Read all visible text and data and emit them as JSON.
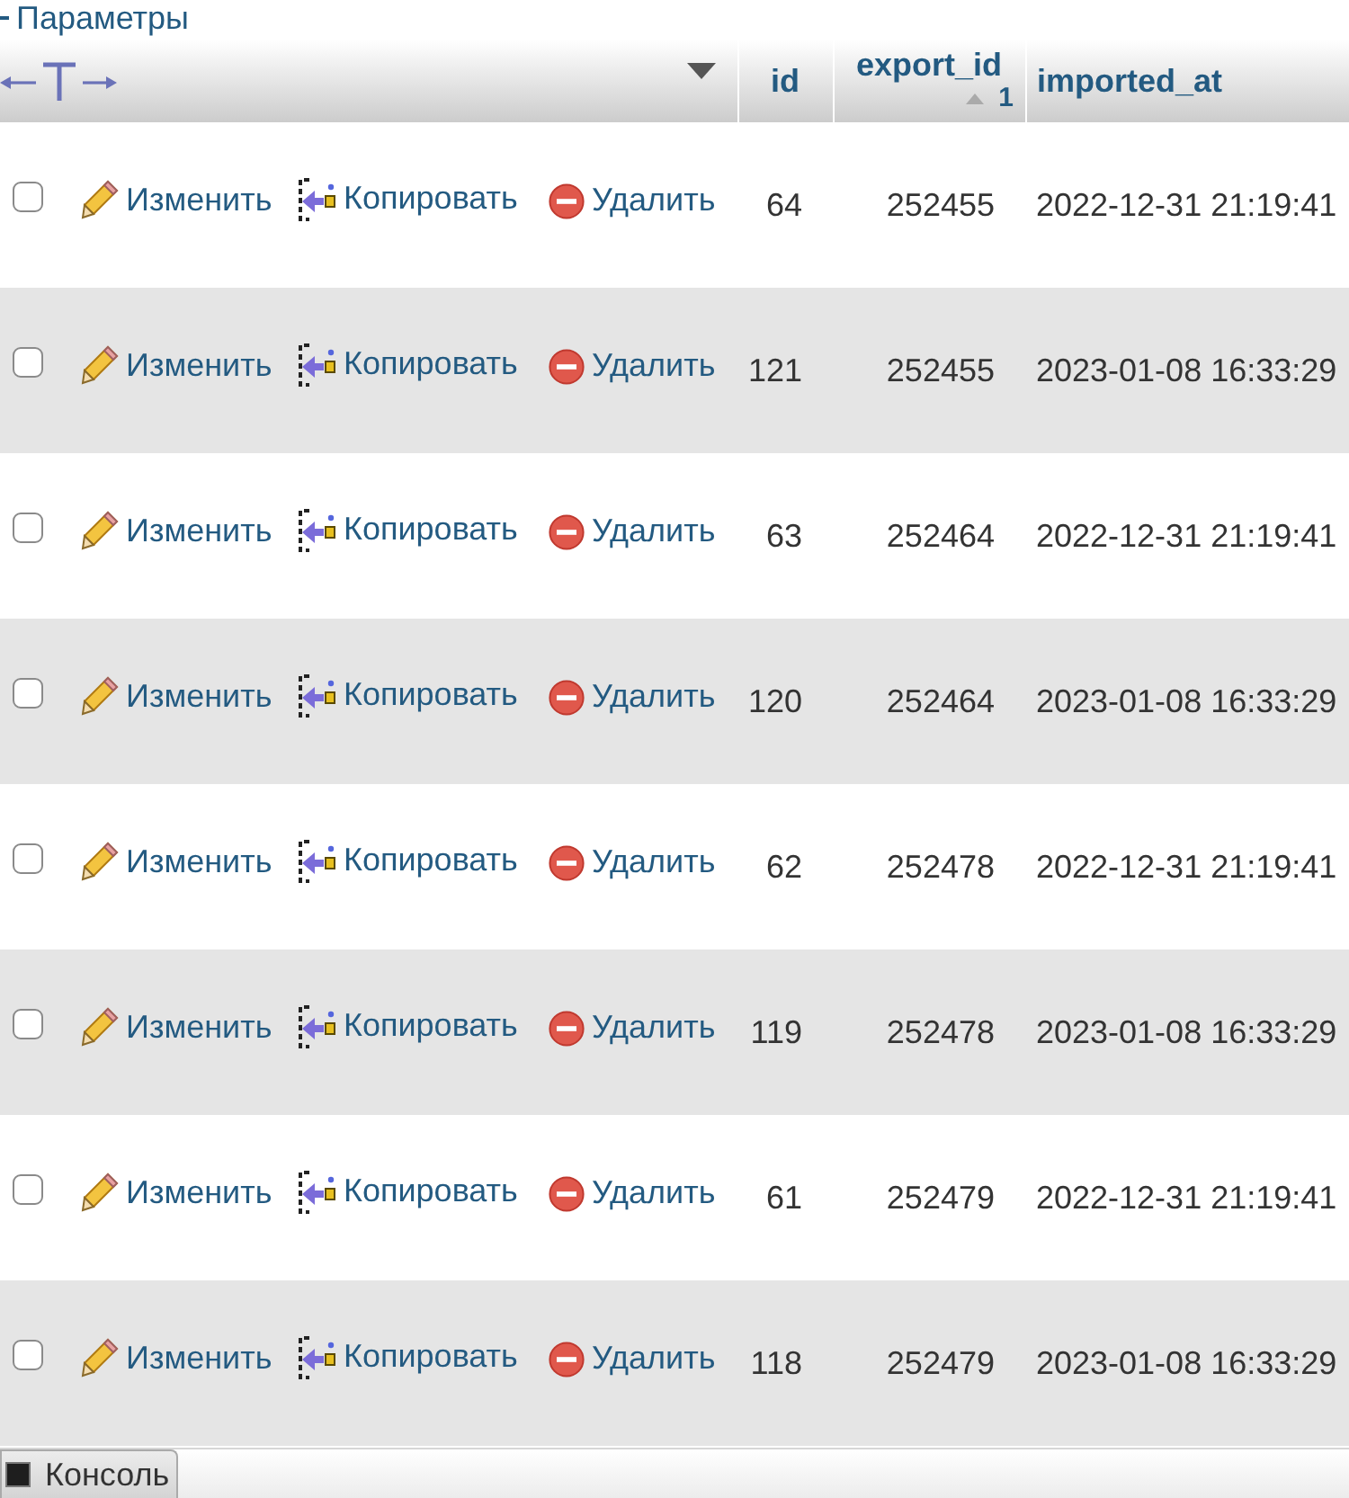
{
  "options_link": {
    "label": "Параметры"
  },
  "columns": [
    {
      "label": "id"
    },
    {
      "label": "export_id",
      "sorted": true,
      "ascending": true,
      "sort_order": "1"
    },
    {
      "label": "imported_at"
    }
  ],
  "rows": [
    {
      "checked": false,
      "actions": [
        {
          "kind": "edit",
          "label": "Изменить"
        },
        {
          "kind": "copy",
          "label": "Копировать"
        },
        {
          "kind": "delete",
          "label": "Удалить"
        }
      ],
      "cells": [
        "64",
        "252455",
        "2022-12-31 21:19:41"
      ]
    },
    {
      "checked": false,
      "actions": [
        {
          "kind": "edit",
          "label": "Изменить"
        },
        {
          "kind": "copy",
          "label": "Копировать"
        },
        {
          "kind": "delete",
          "label": "Удалить"
        }
      ],
      "cells": [
        "121",
        "252455",
        "2023-01-08 16:33:29"
      ]
    },
    {
      "checked": false,
      "actions": [
        {
          "kind": "edit",
          "label": "Изменить"
        },
        {
          "kind": "copy",
          "label": "Копировать"
        },
        {
          "kind": "delete",
          "label": "Удалить"
        }
      ],
      "cells": [
        "63",
        "252464",
        "2022-12-31 21:19:41"
      ]
    },
    {
      "checked": false,
      "actions": [
        {
          "kind": "edit",
          "label": "Изменить"
        },
        {
          "kind": "copy",
          "label": "Копировать"
        },
        {
          "kind": "delete",
          "label": "Удалить"
        }
      ],
      "cells": [
        "120",
        "252464",
        "2023-01-08 16:33:29"
      ]
    },
    {
      "checked": false,
      "actions": [
        {
          "kind": "edit",
          "label": "Изменить"
        },
        {
          "kind": "copy",
          "label": "Копировать"
        },
        {
          "kind": "delete",
          "label": "Удалить"
        }
      ],
      "cells": [
        "62",
        "252478",
        "2022-12-31 21:19:41"
      ]
    },
    {
      "checked": false,
      "actions": [
        {
          "kind": "edit",
          "label": "Изменить"
        },
        {
          "kind": "copy",
          "label": "Копировать"
        },
        {
          "kind": "delete",
          "label": "Удалить"
        }
      ],
      "cells": [
        "119",
        "252478",
        "2023-01-08 16:33:29"
      ]
    },
    {
      "checked": false,
      "actions": [
        {
          "kind": "edit",
          "label": "Изменить"
        },
        {
          "kind": "copy",
          "label": "Копировать"
        },
        {
          "kind": "delete",
          "label": "Удалить"
        }
      ],
      "cells": [
        "61",
        "252479",
        "2022-12-31 21:19:41"
      ]
    },
    {
      "checked": false,
      "actions": [
        {
          "kind": "edit",
          "label": "Изменить"
        },
        {
          "kind": "copy",
          "label": "Копировать"
        },
        {
          "kind": "delete",
          "label": "Удалить"
        }
      ],
      "cells": [
        "118",
        "252479",
        "2023-01-08 16:33:29"
      ]
    }
  ],
  "console": {
    "label": "Консоль"
  }
}
